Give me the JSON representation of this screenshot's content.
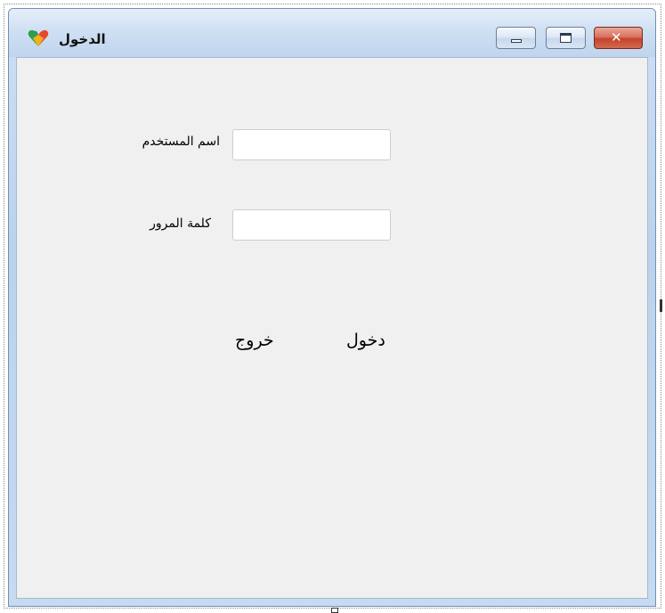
{
  "window": {
    "title": "الدخول",
    "icon": "app-heart-icon",
    "controls": {
      "minimize": "minimize-icon",
      "maximize": "maximize-icon",
      "close_glyph": "✕"
    }
  },
  "form": {
    "username_label": "اسم المستخدم",
    "username_value": "",
    "password_label": "كلمة المرور",
    "password_value": "",
    "login_button": "دخول",
    "exit_button": "خروج"
  },
  "colors": {
    "client_background": "#f0f0f0",
    "titlebar": "#cfe0f3",
    "close_button": "#c4432b"
  }
}
